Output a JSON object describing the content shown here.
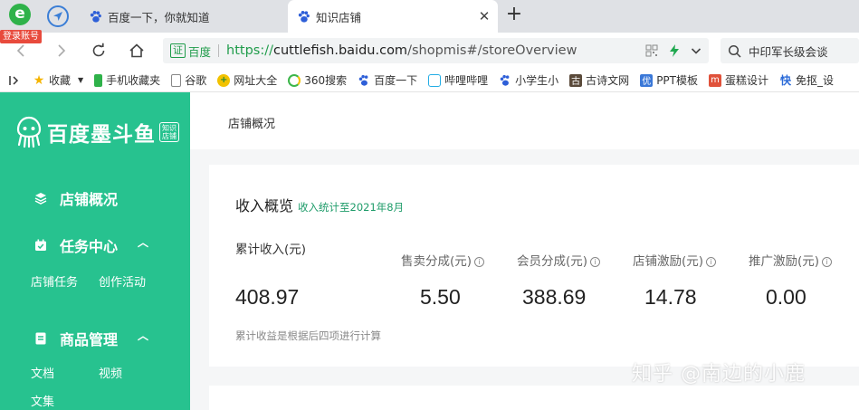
{
  "browser": {
    "login_badge": "登录账号",
    "tabs": [
      {
        "title": "百度一下，你就知道",
        "active": false
      },
      {
        "title": "知识店铺",
        "active": true
      }
    ],
    "new_tab": "+",
    "address": {
      "cert_label": "证",
      "site_label": "百度",
      "url_scheme": "https://",
      "url_host": "cuttlefish.baidu.com",
      "url_path": "/shopmis#/storeOverview"
    },
    "search": {
      "text": "中印军长级会谈"
    },
    "bookmarks": [
      {
        "label": "收藏",
        "icon": "star-icon"
      },
      {
        "label": "手机收藏夹",
        "icon": "phone-icon"
      },
      {
        "label": "谷歌",
        "icon": "page-icon"
      },
      {
        "label": "网址大全",
        "icon": "plus-circle-icon"
      },
      {
        "label": "360搜索",
        "icon": "360-icon"
      },
      {
        "label": "百度一下",
        "icon": "baidu-paw-icon"
      },
      {
        "label": "哔哩哔哩",
        "icon": "bilibili-icon"
      },
      {
        "label": "小学生小",
        "icon": "baidu-paw-icon"
      },
      {
        "label": "古诗文网",
        "icon": "gushiwen-icon"
      },
      {
        "label": "PPT模板",
        "icon": "ppt-icon"
      },
      {
        "label": "蛋糕设计",
        "icon": "design-icon"
      },
      {
        "label": "免抠_设",
        "icon": "kuai-icon"
      }
    ]
  },
  "sidebar": {
    "brand_name": "百度墨斗鱼",
    "brand_tag": "知识店铺",
    "menu": [
      {
        "label": "店铺概况",
        "icon": "layers-icon"
      },
      {
        "label": "任务中心",
        "icon": "calendar-icon",
        "expanded": true,
        "children": [
          "店铺任务",
          "创作活动"
        ]
      },
      {
        "label": "商品管理",
        "icon": "document-icon",
        "expanded": true,
        "children": [
          "文档",
          "视频",
          "文集"
        ]
      }
    ]
  },
  "main": {
    "breadcrumb": "店铺概况",
    "income": {
      "title": "收入概览",
      "subtitle": "收入统计至2021年8月",
      "stats": [
        {
          "label": "累计收入(元)",
          "value": "408.97",
          "info": false
        },
        {
          "label": "售卖分成(元)",
          "value": "5.50",
          "info": true
        },
        {
          "label": "会员分成(元)",
          "value": "388.69",
          "info": true
        },
        {
          "label": "店铺激励(元)",
          "value": "14.78",
          "info": true
        },
        {
          "label": "推广激励(元)",
          "value": "0.00",
          "info": true
        }
      ],
      "note": "累计收益是根据后四项进行计算"
    },
    "watermark": "知乎 @南边的小鹿"
  },
  "colors": {
    "sidebar": "#27c28f",
    "accent_green": "#1f9c4a",
    "badge_red": "#e84a3c"
  }
}
